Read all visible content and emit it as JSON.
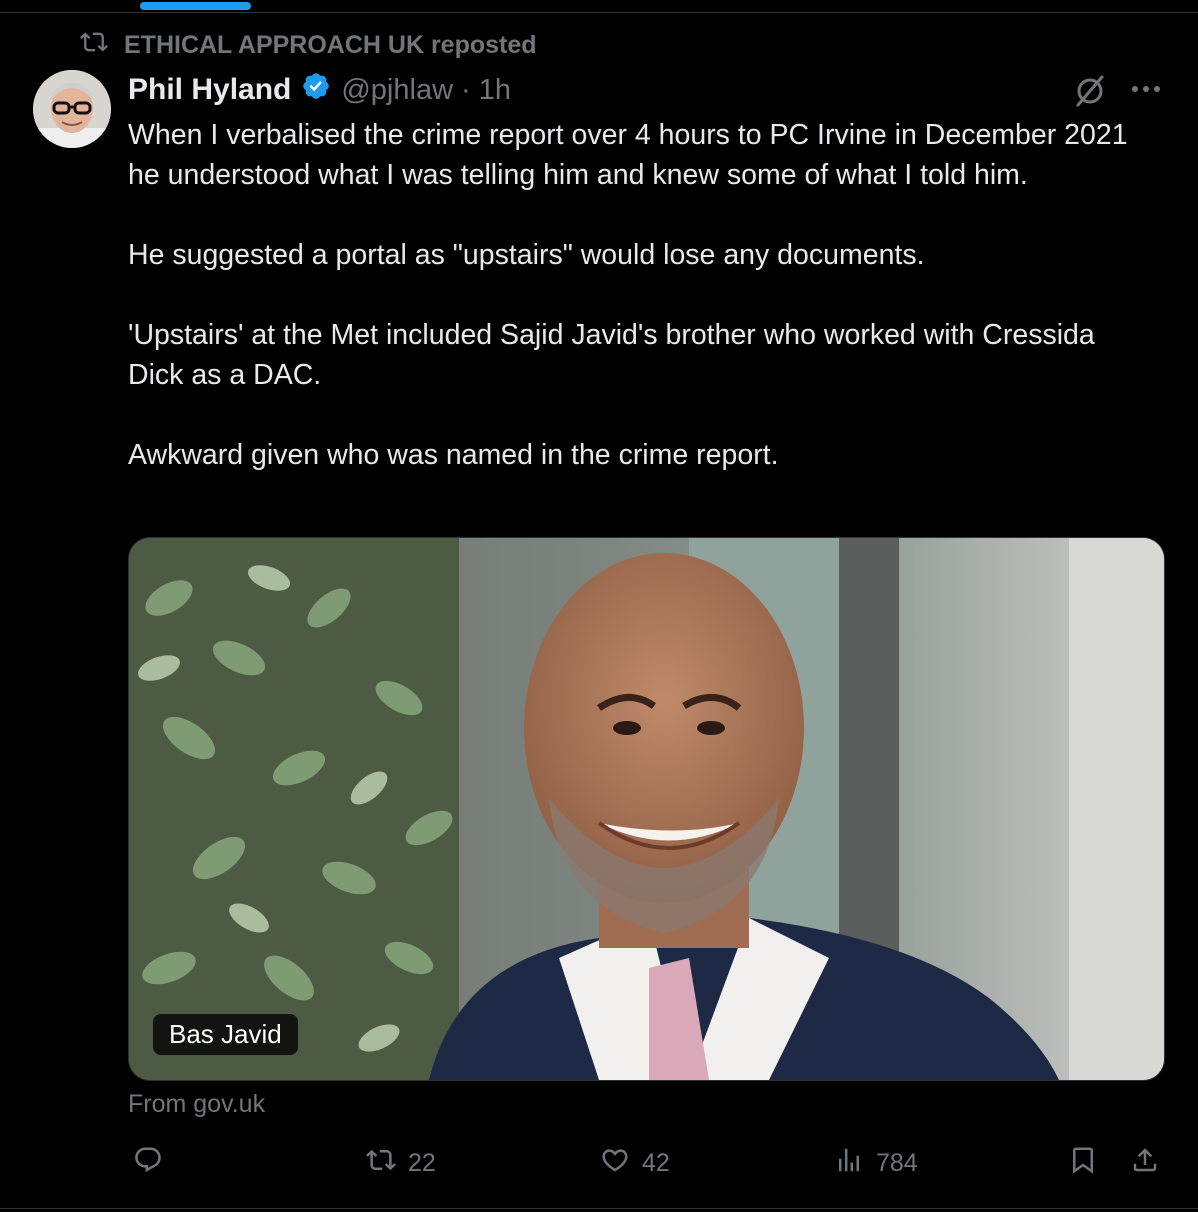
{
  "repost": {
    "label": "ETHICAL APPROACH UK reposted"
  },
  "author": {
    "name": "Phil Hyland",
    "handle": "@pjhlaw",
    "separator": "·",
    "time": "1h"
  },
  "tweet": {
    "text": "When I verbalised the crime report over 4 hours to PC Irvine in December 2021 he understood what I was telling him and knew some of what I told him.\n\nHe suggested a portal as \"upstairs\" would lose any documents.\n\n'Upstairs' at the Met included Sajid Javid's brother who worked with Cressida Dick as a DAC.\n\nAwkward given who was named in the crime report."
  },
  "media": {
    "alt_label": "Bas Javid",
    "source": "From gov.uk"
  },
  "actions": {
    "replies": "",
    "reposts": "22",
    "likes": "42",
    "views": "784"
  },
  "colors": {
    "background": "#000000",
    "text": "#e7e9ea",
    "muted": "#71767b",
    "accent": "#1d9bf0",
    "border": "#2f3336"
  },
  "icons": [
    "repost-icon",
    "verified-badge-icon",
    "grok-icon",
    "more-icon",
    "reply-icon",
    "repost-icon",
    "like-icon",
    "views-icon",
    "bookmark-icon",
    "share-icon"
  ]
}
